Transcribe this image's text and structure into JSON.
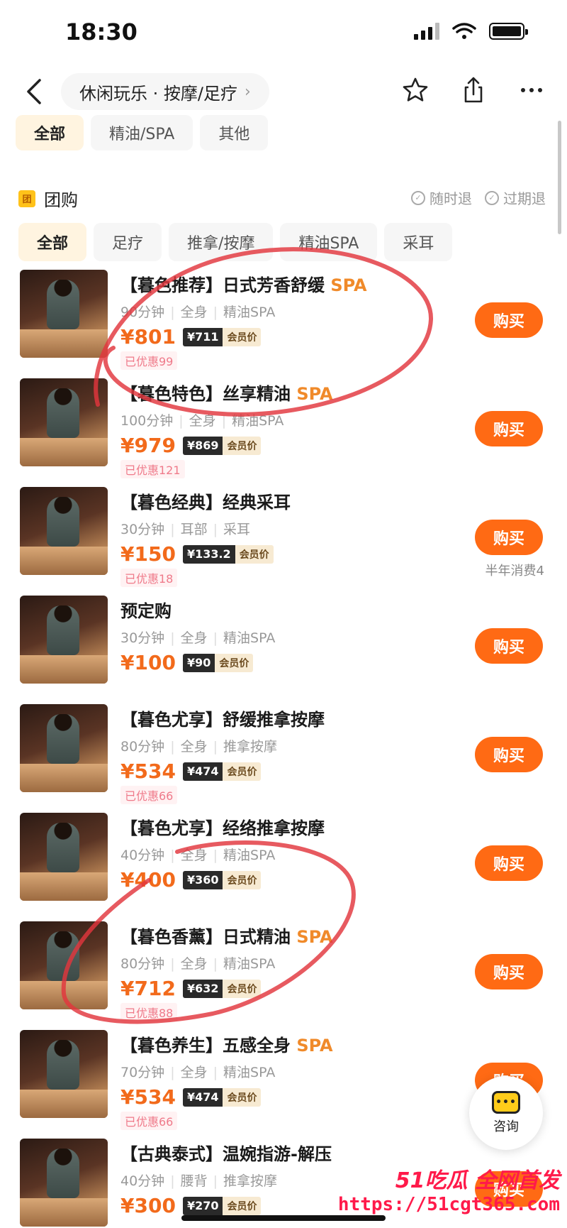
{
  "status": {
    "time": "18:30"
  },
  "nav": {
    "breadcrumb": "休闲玩乐 · 按摩/足疗",
    "breadcrumb_chevron": "›"
  },
  "top_tabs": [
    "全部",
    "精油/SPA",
    "其他"
  ],
  "group": {
    "badge": "团",
    "title": "团购",
    "flags": [
      "随时退",
      "过期退"
    ]
  },
  "sub_tabs": [
    "全部",
    "足疗",
    "推拿/按摩",
    "精油SPA",
    "采耳"
  ],
  "items": [
    {
      "title_pre": "【暮色推荐】日式芳香舒缓 ",
      "title_hl": "SPA",
      "meta": [
        "90分钟",
        "全身",
        "精油SPA"
      ],
      "price": "¥801",
      "member_price": "¥711",
      "member_tag": "会员价",
      "discount": "已优惠99",
      "buy": "购买",
      "note": ""
    },
    {
      "title_pre": "【暮色特色】丝享精油 ",
      "title_hl": "SPA",
      "meta": [
        "100分钟",
        "全身",
        "精油SPA"
      ],
      "price": "¥979",
      "member_price": "¥869",
      "member_tag": "会员价",
      "discount": "已优惠121",
      "buy": "购买",
      "note": ""
    },
    {
      "title_pre": "【暮色经典】经典采耳",
      "title_hl": "",
      "meta": [
        "30分钟",
        "耳部",
        "采耳"
      ],
      "price": "¥150",
      "member_price": "¥133.2",
      "member_tag": "会员价",
      "discount": "已优惠18",
      "buy": "购买",
      "note": "半年消费4"
    },
    {
      "title_pre": "预定购",
      "title_hl": "",
      "meta": [
        "30分钟",
        "全身",
        "精油SPA"
      ],
      "price": "¥100",
      "member_price": "¥90",
      "member_tag": "会员价",
      "discount": "",
      "buy": "购买",
      "note": ""
    },
    {
      "title_pre": "【暮色尤享】舒缓推拿按摩",
      "title_hl": "",
      "meta": [
        "80分钟",
        "全身",
        "推拿按摩"
      ],
      "price": "¥534",
      "member_price": "¥474",
      "member_tag": "会员价",
      "discount": "已优惠66",
      "buy": "购买",
      "note": ""
    },
    {
      "title_pre": "【暮色尤享】经络推拿按摩",
      "title_hl": "",
      "meta": [
        "40分钟",
        "全身",
        "精油SPA"
      ],
      "price": "¥400",
      "member_price": "¥360",
      "member_tag": "会员价",
      "discount": "",
      "buy": "购买",
      "note": ""
    },
    {
      "title_pre": "【暮色香薰】日式精油 ",
      "title_hl": "SPA",
      "meta": [
        "80分钟",
        "全身",
        "精油SPA"
      ],
      "price": "¥712",
      "member_price": "¥632",
      "member_tag": "会员价",
      "discount": "已优惠88",
      "buy": "购买",
      "note": ""
    },
    {
      "title_pre": "【暮色养生】五感全身 ",
      "title_hl": "SPA",
      "meta": [
        "70分钟",
        "全身",
        "精油SPA"
      ],
      "price": "¥534",
      "member_price": "¥474",
      "member_tag": "会员价",
      "discount": "已优惠66",
      "buy": "购买",
      "note": ""
    },
    {
      "title_pre": "【古典泰式】温婉指游-解压",
      "title_hl": "",
      "meta": [
        "40分钟",
        "腰背",
        "推拿按摩"
      ],
      "price": "¥300",
      "member_price": "¥270",
      "member_tag": "会员价",
      "discount": "",
      "buy": "购买",
      "note": ""
    }
  ],
  "consult": {
    "label": "咨询",
    "bubble": "•••"
  },
  "watermark": {
    "brand": "51吃瓜 全网首发",
    "url": "https://51cgt365.com"
  },
  "colors": {
    "accent": "#ff6a14",
    "price": "#f26a1b",
    "annotation": "#e2363d"
  },
  "icons": [
    "back-icon",
    "star-icon",
    "share-icon",
    "more-icon",
    "wifi-icon",
    "battery-icon",
    "check-circle-icon",
    "chat-icon"
  ]
}
